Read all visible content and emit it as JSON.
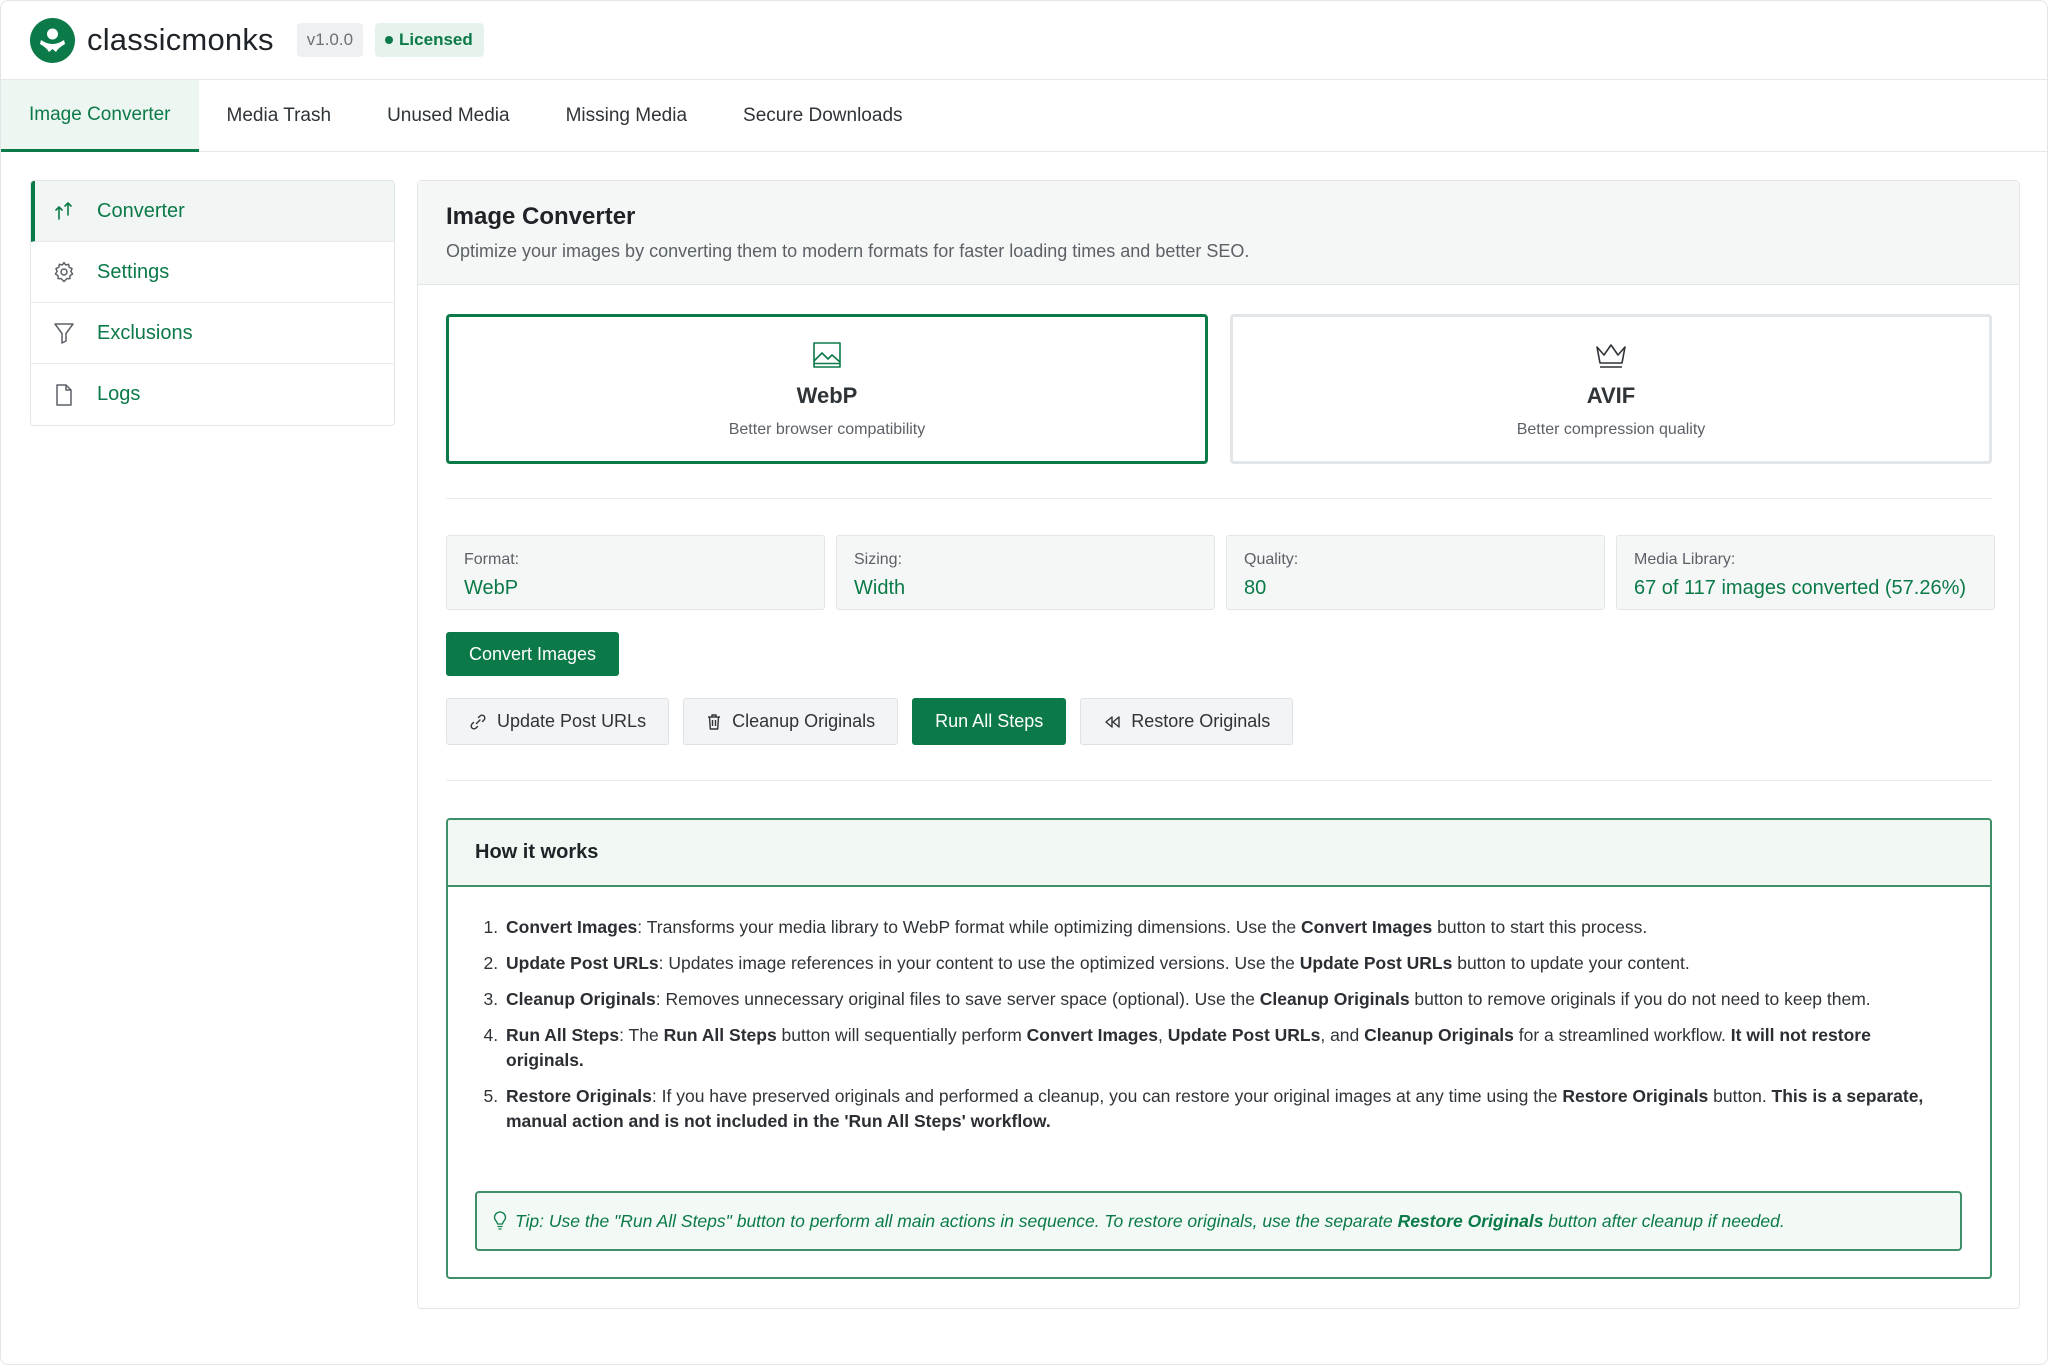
{
  "header": {
    "brand": "classicmonks",
    "version": "v1.0.0",
    "license_badge": "Licensed",
    "logo_icon": "monk-logo-icon"
  },
  "tabs": [
    {
      "label": "Image Converter",
      "active": true
    },
    {
      "label": "Media Trash"
    },
    {
      "label": "Unused Media"
    },
    {
      "label": "Missing Media"
    },
    {
      "label": "Secure Downloads"
    }
  ],
  "sidebar": {
    "items": [
      {
        "label": "Converter",
        "icon": "convert-arrows-icon",
        "active": true
      },
      {
        "label": "Settings",
        "icon": "gear-icon"
      },
      {
        "label": "Exclusions",
        "icon": "filter-icon"
      },
      {
        "label": "Logs",
        "icon": "file-icon"
      }
    ]
  },
  "main": {
    "title": "Image Converter",
    "subtitle": "Optimize your images by converting them to modern formats for faster loading times and better SEO.",
    "formats": [
      {
        "name": "WebP",
        "desc": "Better browser compatibility",
        "icon": "image-icon",
        "selected": true
      },
      {
        "name": "AVIF",
        "desc": "Better compression quality",
        "icon": "crown-icon"
      }
    ],
    "stats": [
      {
        "label": "Format:",
        "value": "WebP"
      },
      {
        "label": "Sizing:",
        "value": "Width"
      },
      {
        "label": "Quality:",
        "value": "80"
      },
      {
        "label": "Media Library:",
        "value": "67 of 117 images converted (57.26%)"
      }
    ],
    "convert_button": "Convert Images",
    "actions": [
      {
        "label": "Update Post URLs",
        "icon": "link-icon"
      },
      {
        "label": "Cleanup Originals",
        "icon": "trash-icon"
      },
      {
        "label": "Run All Steps"
      },
      {
        "label": "Restore Originals",
        "icon": "rewind-icon"
      }
    ]
  },
  "how_it_works": {
    "title": "How it works",
    "steps": [
      {
        "name": "Convert Images",
        "sep": ": ",
        "t1": "Transforms your media library to WebP format while optimizing dimensions. Use the ",
        "b1": "Convert Images",
        "t2": " button to start this process."
      },
      {
        "name": "Update Post URLs",
        "sep": ": ",
        "t1": "Updates image references in your content to use the optimized versions. Use the ",
        "b1": "Update Post URLs",
        "t2": " button to update your content."
      },
      {
        "name": "Cleanup Originals",
        "sep": ": ",
        "t1": "Removes unnecessary original files to save server space (optional). Use the ",
        "b1": "Cleanup Originals",
        "t2": " button to remove originals if you do not need to keep them."
      },
      {
        "name": "Run All Steps",
        "sep": ": ",
        "t1": "The ",
        "b1": "Run All Steps",
        "t2": " button will sequentially perform ",
        "b2": "Convert Images",
        "t3": ", ",
        "b3": "Update Post URLs",
        "t4": ", and ",
        "b4": "Cleanup Originals",
        "t5": " for a streamlined workflow. ",
        "b5": "It will not restore originals."
      },
      {
        "name": "Restore Originals",
        "sep": ": ",
        "t1": "If you have preserved originals and performed a cleanup, you can restore your original images at any time using the ",
        "b1": "Restore Originals",
        "t2": " button. ",
        "b2": "This is a separate, manual action and is not included in the 'Run All Steps' workflow."
      }
    ],
    "tip": {
      "icon": "lightbulb-icon",
      "t1": "Tip: Use the \"Run All Steps\" button to perform all main actions in sequence. To restore originals, use the separate ",
      "b1": "Restore Originals",
      "t2": " button after cleanup if needed."
    }
  },
  "colors": {
    "accent": "#0b7a48",
    "accent_border": "#3f8f68",
    "panel_bg": "#f5f7f6"
  }
}
